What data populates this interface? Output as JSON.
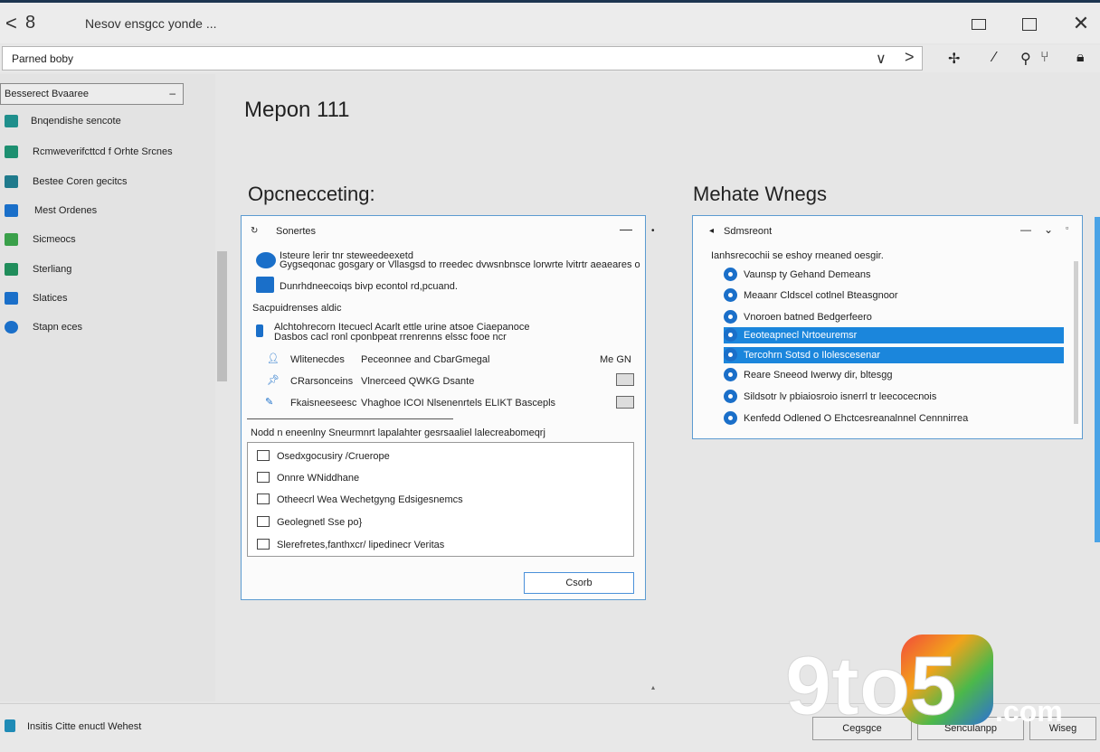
{
  "titlebar": {
    "back": "<",
    "number": "8",
    "title": "Nesov ensgcc yonde ..."
  },
  "address": {
    "value": "Parned boby",
    "chevron": "∨",
    "next": ">",
    "icons": [
      "pin-icon",
      "pen-icon",
      "search-icon",
      "filter-icon",
      "lock-icon"
    ]
  },
  "sidebar": {
    "dropdown": "Besserect Bvaaree",
    "items": [
      {
        "label": "Bnqendishe sencote",
        "color": "#1f8f8c"
      },
      {
        "label": "Rcmweverifcttcd f Orhte Srcnes",
        "color": "#1d8f70"
      },
      {
        "label": "Bestee Coren gecitcs",
        "color": "#1f7a8c"
      },
      {
        "label": "Mest Ordenes",
        "color": "#1a6fc9"
      },
      {
        "label": "Sicmeocs",
        "color": "#3aa04a"
      },
      {
        "label": "Sterliang",
        "color": "#208d5b"
      },
      {
        "label": "Slatices",
        "color": "#1a6fc9"
      },
      {
        "label": "Stapn eces",
        "color": "#1a6fc9"
      }
    ]
  },
  "main": {
    "title": "Mepon 111",
    "left_section": "Opcnecceting:",
    "right_section": "Mehate Wnegs"
  },
  "dialog_left": {
    "header": "Sonertes",
    "line1a": "Isteure lerir tnr steweedeexetd",
    "line1b": "Gygseqonac gosgary or Vllasgsd to rreedec dvwsnbnsce lorwrte lvitrtr aeaeares o",
    "line2": "Dunrhdneecoiqs bivp econtol rd,pcuand.",
    "line3": "Sacpuidrenses aldic",
    "line4a": "Alchtohrecorn Itecuecl Acarlt ettle urine atsoe Ciaepanoce",
    "line4b": "Dasbos cacl ronl cponbpeat rrenrenns elssc fooe ncr",
    "opt1a": "Wlitenecdes",
    "opt1b": "Peceonnee and CbarGmegal",
    "opt1c": "Me GN",
    "opt2a": "CRarsonceins",
    "opt2b": "Vlnerceed QWKG Dsante",
    "opt3a": "Fkaisneeseesc",
    "opt3b": "Vhaghoe ICOI Nlsenenrtels ELIKT Bascepls",
    "field": "Nodd n eneenlny Sneurmnrt lapalahter gesrsaaliel lalecreabomeqrj",
    "list": [
      "Osedxgocusiry /Cruerope",
      "Onnre WNiddhane",
      "Otheecrl Wea Wechetgyng Edsigesnemcs",
      "Geolegnetl Sse po}",
      "Slerefretes,fanthxcr/ lipedinecr Veritas"
    ],
    "ok": "Csorb"
  },
  "dialog_right": {
    "header": "Sdmsreont",
    "intro": "Ianhsrecochii se eshoy rneaned oesgir.",
    "options": [
      {
        "label": "Vaunsp ty Gehand Demeans",
        "selected": false
      },
      {
        "label": "Meaanr Cldscel cotlnel Bteasgnoor",
        "selected": false
      },
      {
        "label": "Vnoroen batned Bedgerfeero",
        "selected": false
      },
      {
        "label": "Eeoteapnecl Nrtoeuremsr",
        "selected": true
      },
      {
        "label": "Tercohrn Sotsd o Ilolescesenar",
        "selected": true
      },
      {
        "label": "Reare Sneeod Iwerwy dir, bltesgg",
        "selected": false
      },
      {
        "label": "Sildsotr lv pbiaiosroio isnerrl tr leecocecnois",
        "selected": false
      },
      {
        "label": "Kenfedd Odlened O Ehctcesreanalnnel Cennnirrea",
        "selected": false
      }
    ]
  },
  "status": {
    "text": "Insitis Citte enuctl Wehest",
    "buttons": [
      "Cegsgce",
      "Senculanpp",
      "Wiseg"
    ]
  },
  "watermark": {
    "text": "9to5",
    "suffix": ".com"
  }
}
